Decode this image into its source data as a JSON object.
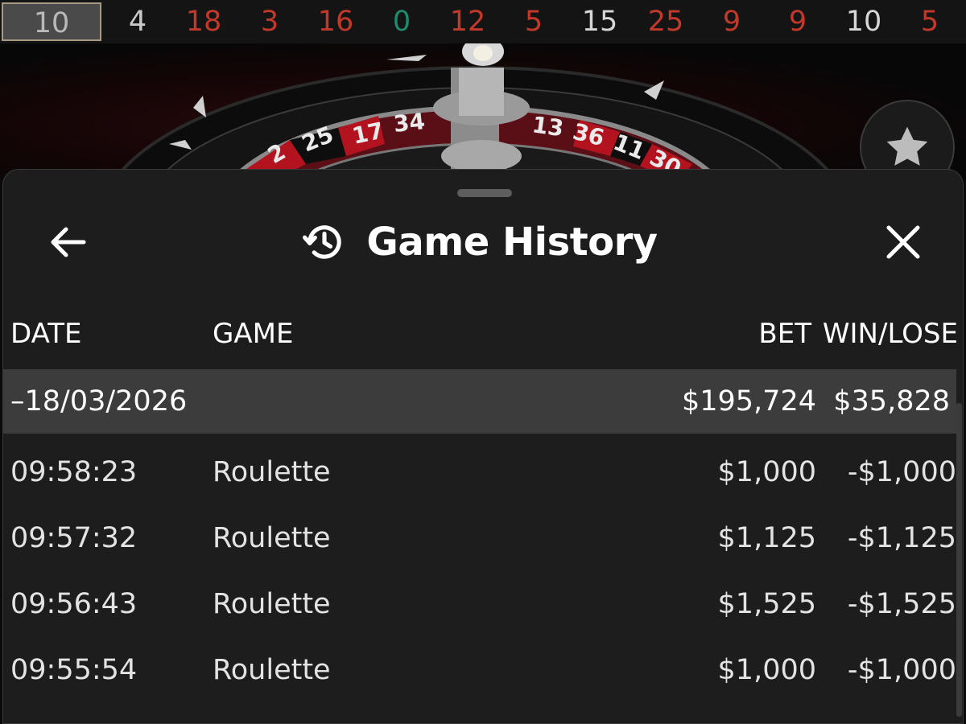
{
  "results_strip": [
    {
      "value": "10",
      "color": "#b9b9b9"
    },
    {
      "value": "4",
      "color": "#c9c9c9"
    },
    {
      "value": "18",
      "color": "#c0392b"
    },
    {
      "value": "3",
      "color": "#c0392b"
    },
    {
      "value": "16",
      "color": "#c0392b"
    },
    {
      "value": "0",
      "color": "#1f8a6c"
    },
    {
      "value": "12",
      "color": "#c0392b"
    },
    {
      "value": "5",
      "color": "#c0392b"
    },
    {
      "value": "15",
      "color": "#d6d6d6"
    },
    {
      "value": "25",
      "color": "#c0392b"
    },
    {
      "value": "9",
      "color": "#c0392b"
    },
    {
      "value": "9",
      "color": "#c0392b"
    },
    {
      "value": "10",
      "color": "#d6d6d6"
    },
    {
      "value": "5",
      "color": "#c0392b"
    }
  ],
  "panel": {
    "title": "Game History"
  },
  "table": {
    "headers": {
      "date": "DATE",
      "game": "GAME",
      "bet": "BET",
      "win_lose": "WIN/LOSE"
    },
    "summary": {
      "date": "–18/03/2026",
      "bet": "$195,724",
      "win_lose": "$35,828"
    },
    "rows": [
      {
        "time": "09:58:23",
        "game": "Roulette",
        "bet": "$1,000",
        "win_lose": "-$1,000"
      },
      {
        "time": "09:57:32",
        "game": "Roulette",
        "bet": "$1,125",
        "win_lose": "-$1,125"
      },
      {
        "time": "09:56:43",
        "game": "Roulette",
        "bet": "$1,525",
        "win_lose": "-$1,525"
      },
      {
        "time": "09:55:54",
        "game": "Roulette",
        "bet": "$1,000",
        "win_lose": "-$1,000"
      }
    ]
  },
  "icons": {
    "back": "arrow-left-icon",
    "history": "history-icon",
    "close": "close-icon",
    "favorite": "star-icon"
  }
}
